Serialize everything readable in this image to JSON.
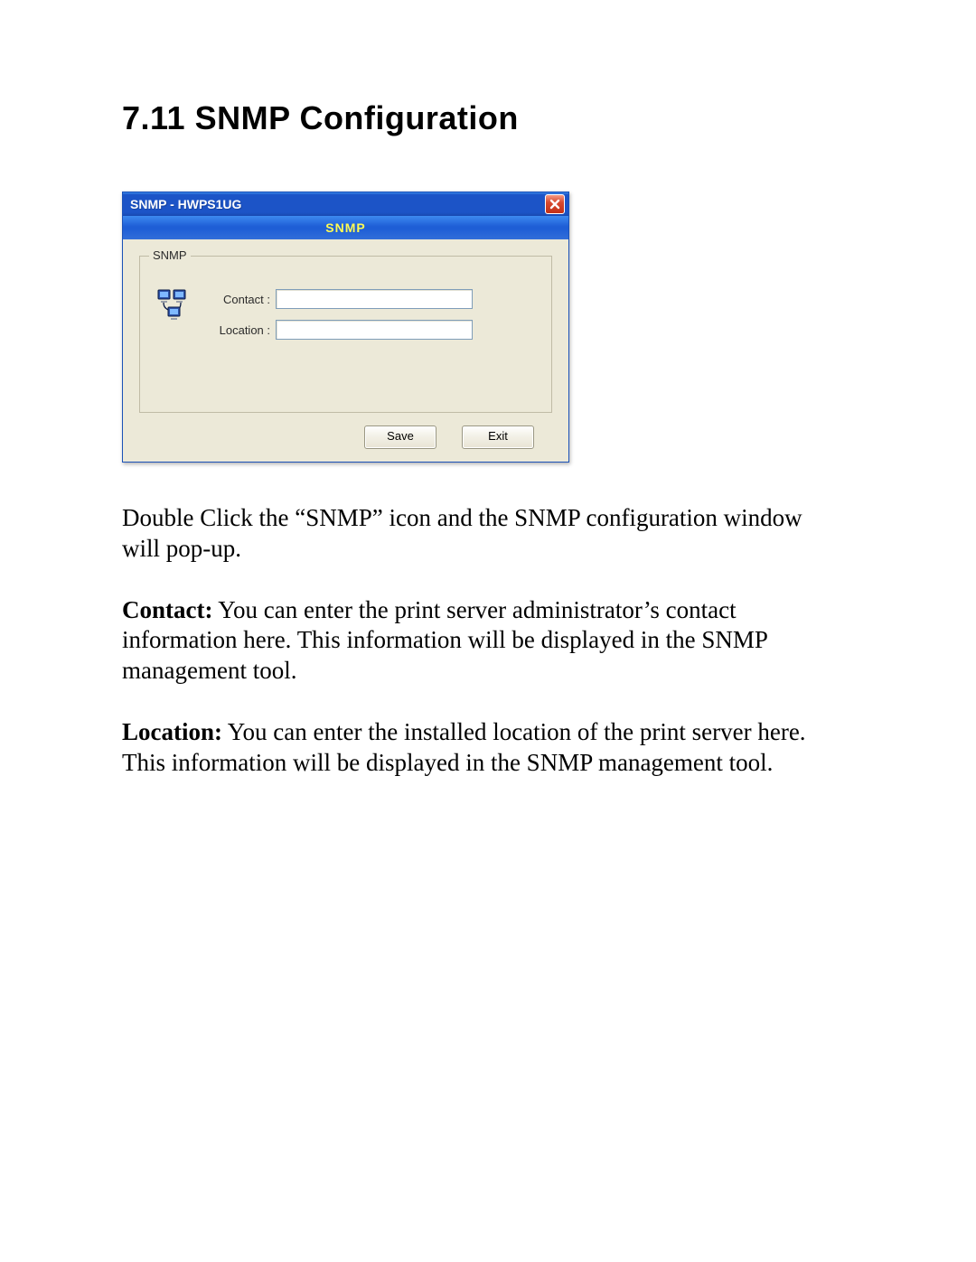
{
  "heading": "7.11  SNMP Configuration",
  "dialog": {
    "title": "SNMP - HWPS1UG",
    "banner": "SNMP",
    "group_label": "SNMP",
    "contact_label": "Contact :",
    "location_label": "Location :",
    "contact_value": "",
    "location_value": "",
    "save_label": "Save",
    "exit_label": "Exit"
  },
  "paragraphs": {
    "intro": "Double Click the “SNMP” icon and the SNMP configuration window will pop-up.",
    "contact_bold": "Contact:",
    "contact_rest": " You can enter the print server administrator’s contact information here. This information will be displayed in the SNMP management tool.",
    "location_bold": "Location:",
    "location_rest": " You can enter the installed location of the print server here. This information will be displayed in the SNMP management tool."
  }
}
